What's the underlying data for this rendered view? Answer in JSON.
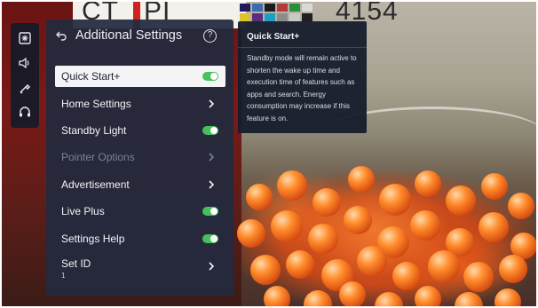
{
  "background": {
    "letters": "CT",
    "letters2": "PI",
    "number": "4154",
    "swatch_colors": [
      "#1d1d5e",
      "#3b6bb0",
      "#1b1b1b",
      "#b23c3c",
      "#2a8f3a",
      "#d8d8d8",
      "#e1c22c",
      "#5a2c82",
      "#1aa0c8",
      "#8c8c8c",
      "#c8c8c8",
      "#202020"
    ]
  },
  "rail": {
    "icons": [
      "picture-icon",
      "sound-icon",
      "general-icon",
      "support-icon"
    ]
  },
  "panel": {
    "title": "Additional Settings",
    "help": "?",
    "items": [
      {
        "label": "Quick Start+",
        "control": "toggle",
        "on": true,
        "selected": true
      },
      {
        "label": "Home Settings",
        "control": "chevron"
      },
      {
        "label": "Standby Light",
        "control": "toggle",
        "on": true
      },
      {
        "label": "Pointer Options",
        "control": "chevron",
        "disabled": true
      },
      {
        "label": "Advertisement",
        "control": "chevron"
      },
      {
        "label": "Live Plus",
        "control": "toggle",
        "on": true
      },
      {
        "label": "Settings Help",
        "control": "toggle",
        "on": true
      },
      {
        "label": "Set ID",
        "sub": "1",
        "control": "chevron"
      }
    ]
  },
  "tooltip": {
    "title": "Quick Start+",
    "body": "Standby mode will remain active to shorten the wake up time and execution time of features such as apps and search. Energy consumption may increase if this feature is on."
  },
  "colors": {
    "accent_toggle": "#46c05a",
    "panel_bg": "#222a3e"
  }
}
